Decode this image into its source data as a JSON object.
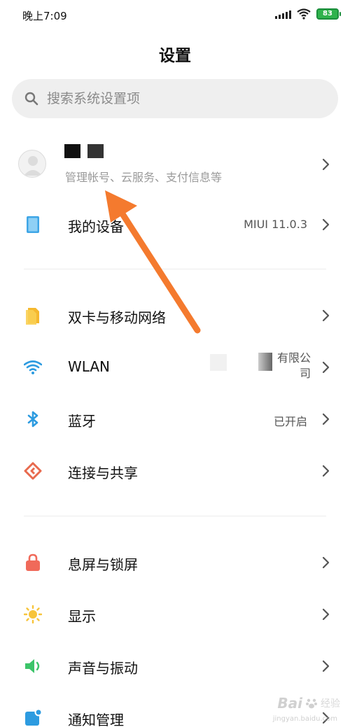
{
  "status_bar": {
    "time": "晚上7:09",
    "battery": "83",
    "battery_color": "#2fb24c",
    "icons": [
      "signal-icon",
      "wifi-icon",
      "battery-icon"
    ]
  },
  "header": {
    "title": "设置"
  },
  "search": {
    "placeholder": "搜索系统设置项",
    "icon": "search-icon"
  },
  "account": {
    "subtitle": "管理帐号、云服务、支付信息等",
    "icon": "avatar-icon"
  },
  "groups": [
    {
      "items": [
        {
          "label": "我的设备",
          "value": "MIUI 11.0.3",
          "icon": "device-icon",
          "color": "#3fa6e6"
        }
      ]
    },
    {
      "items": [
        {
          "label": "双卡与移动网络",
          "value": "",
          "icon": "sim-icon",
          "color": "#f5b82e"
        },
        {
          "label": "WLAN",
          "value": "有限公司",
          "icon": "wifi-icon",
          "color": "#2d9be0"
        },
        {
          "label": "蓝牙",
          "value": "已开启",
          "icon": "bluetooth-icon",
          "color": "#2d9be0"
        },
        {
          "label": "连接与共享",
          "value": "",
          "icon": "share-icon",
          "color": "#e86a4e"
        }
      ]
    },
    {
      "items": [
        {
          "label": "息屏与锁屏",
          "value": "",
          "icon": "lock-icon",
          "color": "#f06a5a"
        },
        {
          "label": "显示",
          "value": "",
          "icon": "sun-icon",
          "color": "#f7c43a"
        },
        {
          "label": "声音与振动",
          "value": "",
          "icon": "speaker-icon",
          "color": "#3cc469"
        },
        {
          "label": "通知管理",
          "value": "",
          "icon": "notification-icon",
          "color": "#2d9be0"
        }
      ]
    }
  ],
  "annotation": {
    "color": "#f47a2e"
  },
  "watermark": {
    "text": "Bai",
    "text2": "经验",
    "sub": "jingyan.baidu.com"
  }
}
